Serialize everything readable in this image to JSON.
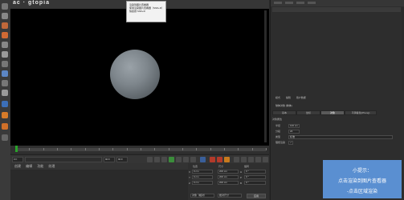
{
  "watermark": "ac · gtopia",
  "tooltip": {
    "lines": [
      "渲染到图片查看器",
      "使用渲染图片查看器（Shift+R）",
      "快捷键 Shift+R"
    ]
  },
  "timeline": {
    "start_frame": "0 F",
    "end_frame": "90 F"
  },
  "transport": {
    "current_frame": "0 F",
    "field_a": "0 F",
    "field_b": "90 F",
    "field_c": "90 F"
  },
  "material_manager": {
    "menu": [
      "创建",
      "编辑",
      "功能",
      "纹理"
    ]
  },
  "coordinates": {
    "headers": [
      "位置",
      "尺寸",
      "旋转"
    ],
    "rows": [
      {
        "axis": "X",
        "pos": "0 cm",
        "size": "200 cm",
        "rot_label": "H",
        "rot": "0 °"
      },
      {
        "axis": "Y",
        "pos": "0 cm",
        "size": "200 cm",
        "rot_label": "P",
        "rot": "0 °"
      },
      {
        "axis": "Z",
        "pos": "0 cm",
        "size": "200 cm",
        "rot_label": "B",
        "rot": "0 °"
      }
    ],
    "mode": "对象（相对）",
    "size_mode": "绝对尺寸",
    "apply": "应用"
  },
  "attributes": {
    "menu": [
      "模式",
      "编辑",
      "用户数据"
    ],
    "title": "球体对象 [球体]",
    "tabs": [
      "基本",
      "坐标",
      "对象",
      "平滑着色(Phong)"
    ],
    "active_tab": 2,
    "section": "对象属性",
    "rows": [
      {
        "label": "半径",
        "value": "100 cm"
      },
      {
        "label": "分段",
        "value": "24"
      },
      {
        "label": "类型",
        "value": "标准"
      },
      {
        "label": "理想渲染",
        "value": "✓"
      }
    ]
  },
  "tip": {
    "lines": [
      "小提示：",
      "点击渲染到图片查看器",
      "-点击区域渲染"
    ]
  },
  "colors": {
    "accent": "#5a8fd1",
    "playhead": "#29a32a"
  }
}
